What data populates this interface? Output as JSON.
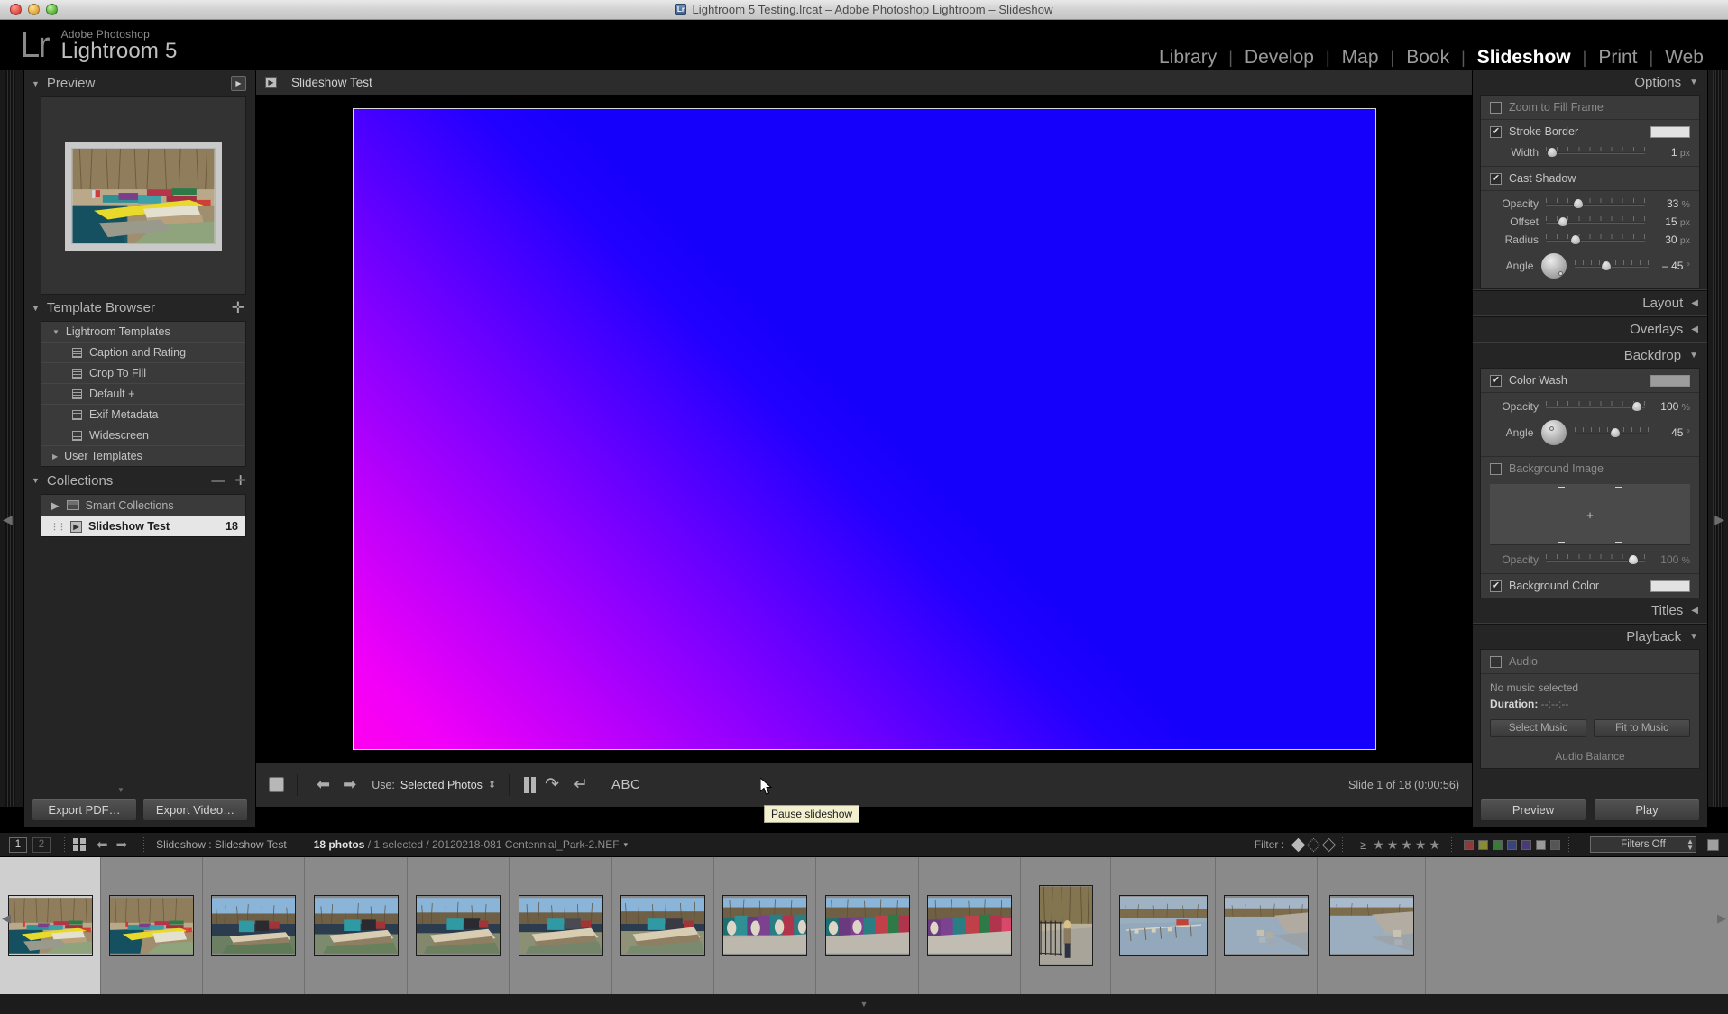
{
  "window": {
    "title": "Lightroom 5 Testing.lrcat – Adobe Photoshop Lightroom – Slideshow",
    "badge_text": "Lr"
  },
  "identity": {
    "logo": "Lr",
    "app_small": "Adobe Photoshop",
    "app_big": "Lightroom 5"
  },
  "modules": {
    "items": [
      {
        "label": "Library",
        "active": false
      },
      {
        "label": "Develop",
        "active": false
      },
      {
        "label": "Map",
        "active": false
      },
      {
        "label": "Book",
        "active": false
      },
      {
        "label": "Slideshow",
        "active": true
      },
      {
        "label": "Print",
        "active": false
      },
      {
        "label": "Web",
        "active": false
      }
    ],
    "separator": "|"
  },
  "left_panel": {
    "preview": {
      "title": "Preview",
      "play_icon": "play-box-icon"
    },
    "template_browser": {
      "title": "Template Browser",
      "add_icon": "plus-icon",
      "groups": [
        {
          "label": "Lightroom Templates",
          "expanded": true,
          "tri": "▼"
        },
        {
          "label": "Caption and Rating",
          "item": true
        },
        {
          "label": "Crop To Fill",
          "item": true
        },
        {
          "label": "Default  +",
          "item": true
        },
        {
          "label": "Exif Metadata",
          "item": true
        },
        {
          "label": "Widescreen",
          "item": true
        },
        {
          "label": "User Templates",
          "expanded": false,
          "tri": "▶"
        }
      ]
    },
    "collections": {
      "title": "Collections",
      "minus_icon": "minus-icon",
      "plus_icon": "plus-icon",
      "rows": [
        {
          "label": "Smart Collections",
          "count": "",
          "selected": false,
          "icon": "smart-collection-icon",
          "tri": "▶"
        },
        {
          "label": "Slideshow Test",
          "count": "18",
          "selected": true,
          "icon": "slideshow-collection-icon"
        }
      ]
    },
    "buttons": [
      {
        "label": "Export PDF…"
      },
      {
        "label": "Export Video…"
      }
    ]
  },
  "center": {
    "header_title": "Slideshow Test",
    "header_icon": "slideshow-collection-icon",
    "slide_gradient": {
      "from": "#ff00f0",
      "to": "#1400fb",
      "angle": "45deg"
    },
    "toolbar": {
      "stop_icon": "stop-square-icon",
      "prev_icon": "left-arrow-icon",
      "next_icon": "right-arrow-icon",
      "use_label": "Use:",
      "use_value": "Selected Photos",
      "pause_icon": "pause-icon",
      "loop_icon": "loop-icon",
      "rewind_icon": "return-icon",
      "abc_label": "ABC",
      "slide_counter": "Slide 1 of 18 (0:00:56)",
      "tooltip": "Pause slideshow"
    }
  },
  "right_panel": {
    "sections": {
      "options": {
        "title": "Options",
        "expanded": true,
        "zoom_to_fill": {
          "label": "Zoom to Fill Frame",
          "checked": false
        },
        "stroke_border": {
          "label": "Stroke Border",
          "checked": true,
          "color": "#e2e2e2"
        },
        "stroke_width": {
          "label": "Width",
          "value": "1",
          "unit": "px",
          "pos": 6
        },
        "cast_shadow": {
          "label": "Cast Shadow",
          "checked": true
        },
        "shadow_sliders": [
          {
            "label": "Opacity",
            "value": "33",
            "unit": "%",
            "pos": 33
          },
          {
            "label": "Offset",
            "value": "15",
            "unit": "px",
            "pos": 17
          },
          {
            "label": "Radius",
            "value": "30",
            "unit": "px",
            "pos": 30
          }
        ],
        "shadow_angle": {
          "label": "Angle",
          "value": "– 45",
          "unit": "°",
          "pos": 40
        }
      },
      "layout": {
        "title": "Layout",
        "expanded": false
      },
      "overlays": {
        "title": "Overlays",
        "expanded": false
      },
      "backdrop": {
        "title": "Backdrop",
        "expanded": true,
        "color_wash": {
          "label": "Color Wash",
          "checked": true,
          "color": "#9d9d9d"
        },
        "wash_opacity": {
          "label": "Opacity",
          "value": "100",
          "unit": "%",
          "pos": 92
        },
        "wash_angle": {
          "label": "Angle",
          "value": "45",
          "unit": "°",
          "pos": 55
        },
        "background_image": {
          "label": "Background Image",
          "checked": false,
          "drop_hint": "+"
        },
        "bgimage_opacity": {
          "label": "Opacity",
          "value": "100",
          "unit": "%",
          "pos": 88,
          "dim": true
        },
        "background_color": {
          "label": "Background Color",
          "checked": true,
          "color": "#e2e2e2"
        }
      },
      "titles": {
        "title": "Titles",
        "expanded": false
      },
      "playback": {
        "title": "Playback",
        "expanded": true,
        "audio": {
          "label": "Audio",
          "checked": false
        },
        "no_music": "No music selected",
        "duration_label": "Duration:",
        "duration_value": "--:--:--",
        "select_music": "Select Music",
        "fit_to_music": "Fit to Music",
        "audio_balance": "Audio Balance"
      }
    },
    "buttons": [
      {
        "label": "Preview"
      },
      {
        "label": "Play"
      }
    ]
  },
  "filmstrip_bar": {
    "screen_1": "1",
    "screen_2": "2",
    "grid_icon": "grid-view-icon",
    "back_icon": "left-arrow-icon",
    "forward_icon": "right-arrow-icon",
    "breadcrumb": "Slideshow : Slideshow Test",
    "photo_count": "18 photos",
    "selected_info": " / 1 selected / 20120218-081 Centennial_Park-2.NEF",
    "caret": "▾",
    "filter_label": "Filter :",
    "flags": [
      "flag-flagged-icon",
      "flag-unflagged-icon",
      "flag-rejected-icon"
    ],
    "rating_op": "≥",
    "stars": "★★★★★",
    "colors": [
      "#8f3a3a",
      "#8a8a37",
      "#3a7a3a",
      "#3a437e",
      "#4a3a7a",
      "#9a9a9a",
      "#555555"
    ],
    "filters_off": "Filters Off",
    "filter_toggle_icon": "filter-toggle-icon"
  },
  "filmstrip": {
    "thumbnails": [
      {
        "id": "1",
        "selected": true,
        "orientation": "landscape",
        "scene": "boats-dock-yellow"
      },
      {
        "id": "2",
        "selected": false,
        "orientation": "landscape",
        "scene": "boats-dock-yellow"
      },
      {
        "id": "3",
        "selected": false,
        "orientation": "landscape",
        "scene": "canoes-lake"
      },
      {
        "id": "4",
        "selected": false,
        "orientation": "landscape",
        "scene": "canoes-lake"
      },
      {
        "id": "5",
        "selected": false,
        "orientation": "landscape",
        "scene": "canoes-lake"
      },
      {
        "id": "6",
        "selected": false,
        "orientation": "landscape",
        "scene": "canoes-lake"
      },
      {
        "id": "7",
        "selected": false,
        "orientation": "landscape",
        "scene": "canoes-lake"
      },
      {
        "id": "8",
        "selected": false,
        "orientation": "landscape",
        "scene": "kayaks-row"
      },
      {
        "id": "9",
        "selected": false,
        "orientation": "landscape",
        "scene": "kayaks-row"
      },
      {
        "id": "10",
        "selected": false,
        "orientation": "landscape",
        "scene": "kayaks-row"
      },
      {
        "id": "11",
        "selected": false,
        "orientation": "portrait",
        "scene": "gate-person"
      },
      {
        "id": "12",
        "selected": false,
        "orientation": "landscape",
        "scene": "dock-reflection"
      },
      {
        "id": "13",
        "selected": false,
        "orientation": "landscape",
        "scene": "lake-rocks"
      },
      {
        "id": "14",
        "selected": false,
        "orientation": "landscape",
        "scene": "lake-rocks"
      }
    ]
  }
}
